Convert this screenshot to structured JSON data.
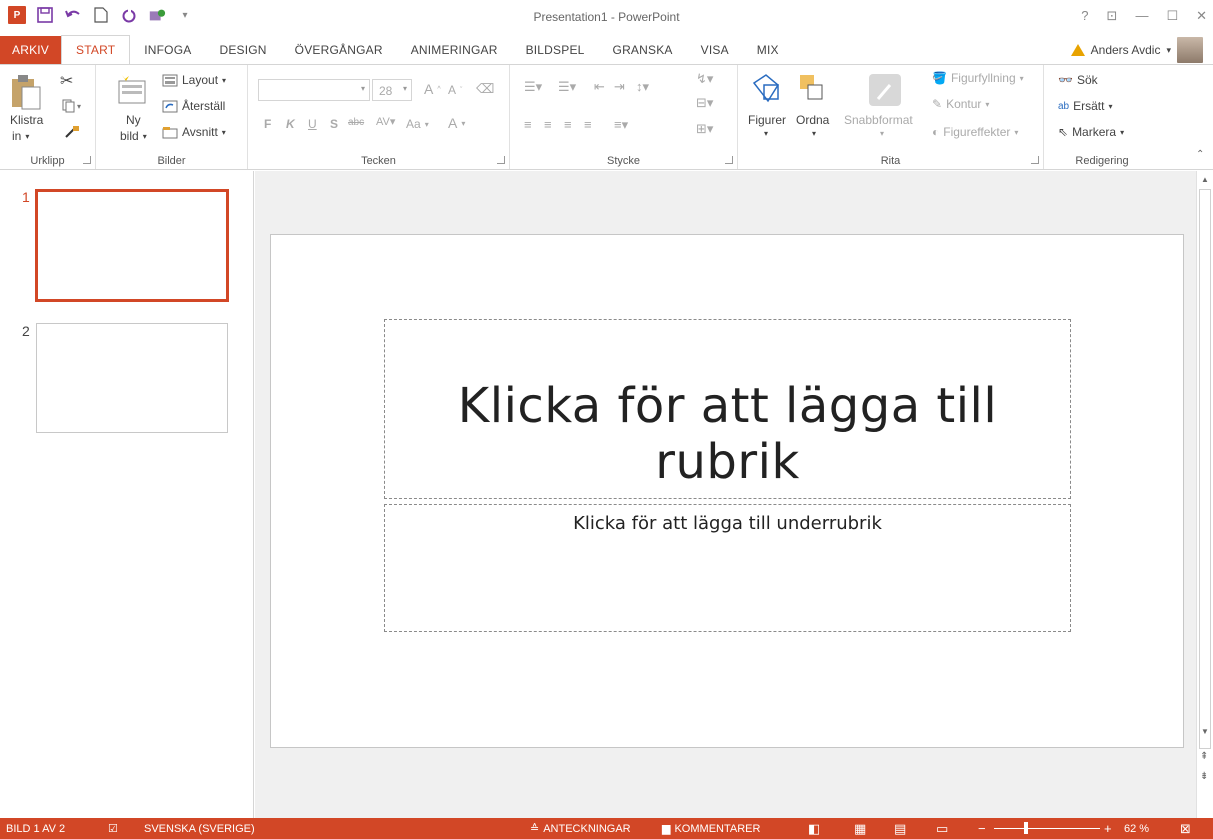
{
  "window": {
    "title": "Presentation1 - PowerPoint",
    "app_logo": "P"
  },
  "tabs": [
    {
      "label": "ARKIV"
    },
    {
      "label": "START"
    },
    {
      "label": "INFOGA"
    },
    {
      "label": "DESIGN"
    },
    {
      "label": "ÖVERGÅNGAR"
    },
    {
      "label": "ANIMERINGAR"
    },
    {
      "label": "BILDSPEL"
    },
    {
      "label": "GRANSKA"
    },
    {
      "label": "VISA"
    },
    {
      "label": "MIX"
    }
  ],
  "account": {
    "name": "Anders Avdic"
  },
  "ribbon": {
    "clipboard": {
      "paste": "Klistra",
      "paste_more": "in",
      "group": "Urklipp"
    },
    "slides": {
      "new": "Ny",
      "new_more": "bild",
      "layout": "Layout",
      "reset": "Återställ",
      "section": "Avsnitt",
      "group": "Bilder"
    },
    "font": {
      "size": "28",
      "bold": "F",
      "italic": "K",
      "underline": "U",
      "shadow": "S",
      "strike": "abc",
      "case": "Aa",
      "group": "Tecken"
    },
    "paragraph": {
      "group": "Stycke"
    },
    "drawing": {
      "shapes": "Figurer",
      "arrange": "Ordna",
      "quick": "Snabbformat",
      "fill": "Figurfyllning",
      "outline": "Kontur",
      "effects": "Figureffekter",
      "group": "Rita"
    },
    "editing": {
      "find": "Sök",
      "replace": "Ersätt",
      "select": "Markera",
      "group": "Redigering"
    }
  },
  "slides": [
    {
      "number": "1"
    },
    {
      "number": "2"
    }
  ],
  "slide": {
    "title_placeholder": "Klicka för att lägga till rubrik",
    "subtitle_placeholder": "Klicka för att lägga till underrubrik"
  },
  "statusbar": {
    "slide_info": "BILD 1 AV 2",
    "language": "SVENSKA (SVERIGE)",
    "notes": "ANTECKNINGAR",
    "comments": "KOMMENTARER",
    "zoom": "62 %"
  },
  "colors": {
    "accent": "#d24726"
  }
}
